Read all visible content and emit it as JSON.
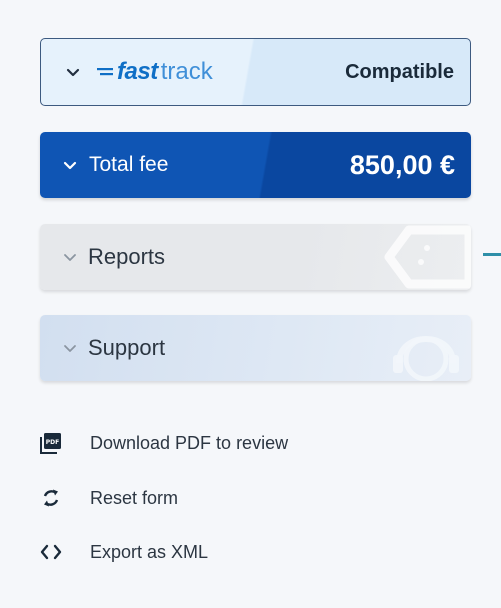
{
  "fast_track": {
    "logo_fast": "fast",
    "logo_track": "track",
    "status": "Compatible"
  },
  "total_fee": {
    "label": "Total fee",
    "amount": "850,00 €"
  },
  "reports": {
    "label": "Reports"
  },
  "support": {
    "label": "Support"
  },
  "actions": [
    {
      "label": "Download PDF to review",
      "icon": "pdf-icon",
      "icon_text": "PDF"
    },
    {
      "label": "Reset form",
      "icon": "refresh-icon"
    },
    {
      "label": "Export as XML",
      "icon": "code-icon",
      "icon_text": "<>"
    }
  ],
  "colors": {
    "brand_blue": "#0f55b4",
    "brand_blue_dark": "#0a47a0",
    "fast_track_blue": "#0f6fc6",
    "connector_teal": "#2e8fa8"
  }
}
